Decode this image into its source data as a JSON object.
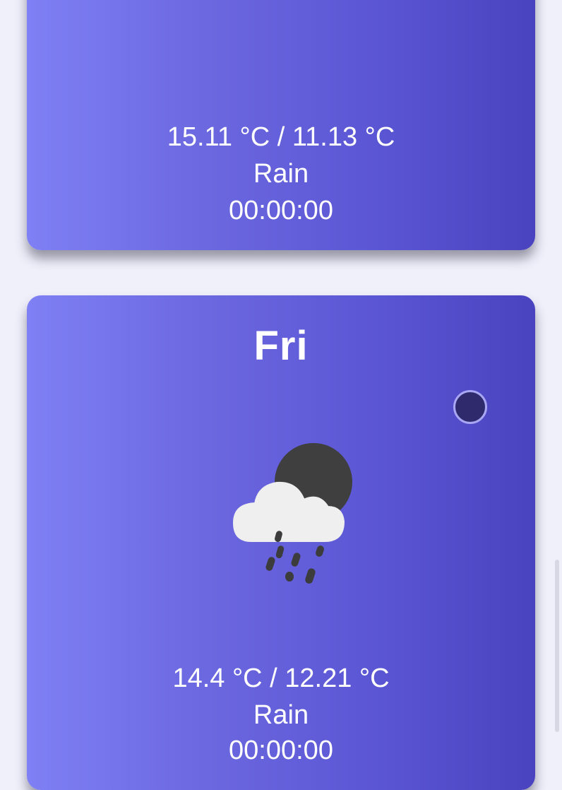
{
  "forecast": [
    {
      "day": "",
      "temperature": "15.11 °C / 11.13 °C",
      "condition": "Rain",
      "time": "00:00:00",
      "icon": "cloud-rain-moon-icon"
    },
    {
      "day": "Fri",
      "temperature": "14.4 °C / 12.21 °C",
      "condition": "Rain",
      "time": "00:00:00",
      "icon": "cloud-rain-moon-icon"
    }
  ],
  "colors": {
    "page_background": "#f0f0fb",
    "card_gradient_start": "#7f80f4",
    "card_gradient_end": "#4a43bf",
    "text": "#ffffff",
    "cloud": "#efefef",
    "moon": "#3f3f3f",
    "rain": "#3c3c3c"
  }
}
